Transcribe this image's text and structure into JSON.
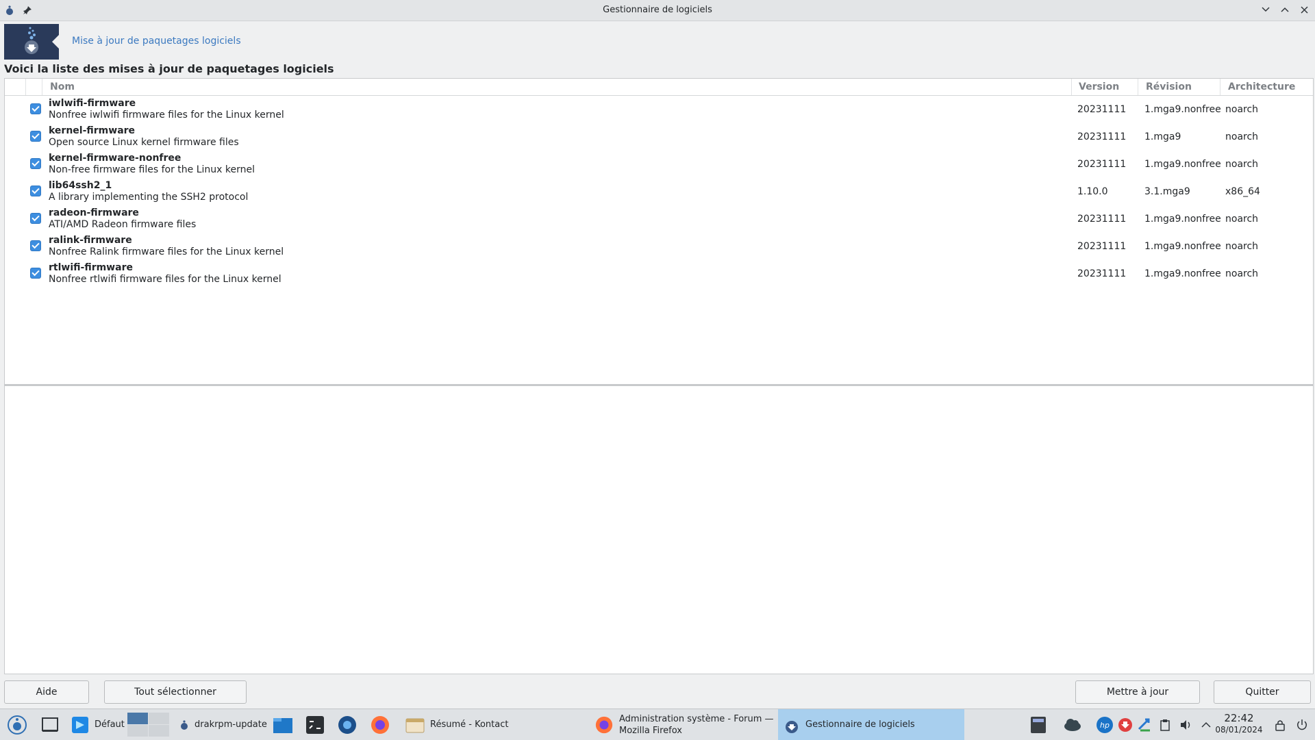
{
  "window": {
    "title": "Gestionnaire de logiciels"
  },
  "header": {
    "link": "Mise à jour de paquetages logiciels",
    "heading": "Voici la liste des mises à jour de paquetages logiciels"
  },
  "table": {
    "columns": [
      "Nom",
      "Version",
      "Révision",
      "Architecture"
    ],
    "rows": [
      {
        "name": "iwlwifi-firmware",
        "desc": "Nonfree iwlwifi firmware files for the Linux kernel",
        "version": "20231111",
        "revision": "1.mga9.nonfree",
        "arch": "noarch",
        "checked": true
      },
      {
        "name": "kernel-firmware",
        "desc": "Open source Linux kernel firmware files",
        "version": "20231111",
        "revision": "1.mga9",
        "arch": "noarch",
        "checked": true
      },
      {
        "name": "kernel-firmware-nonfree",
        "desc": "Non-free firmware files for the Linux kernel",
        "version": "20231111",
        "revision": "1.mga9.nonfree",
        "arch": "noarch",
        "checked": true
      },
      {
        "name": "lib64ssh2_1",
        "desc": "A library implementing the SSH2 protocol",
        "version": "1.10.0",
        "revision": "3.1.mga9",
        "arch": "x86_64",
        "checked": true
      },
      {
        "name": "radeon-firmware",
        "desc": "ATI/AMD Radeon firmware files",
        "version": "20231111",
        "revision": "1.mga9.nonfree",
        "arch": "noarch",
        "checked": true
      },
      {
        "name": "ralink-firmware",
        "desc": "Nonfree Ralink firmware files for the Linux kernel",
        "version": "20231111",
        "revision": "1.mga9.nonfree",
        "arch": "noarch",
        "checked": true
      },
      {
        "name": "rtlwifi-firmware",
        "desc": "Nonfree rtlwifi firmware files for the Linux kernel",
        "version": "20231111",
        "revision": "1.mga9.nonfree",
        "arch": "noarch",
        "checked": true
      }
    ]
  },
  "buttons": {
    "help": "Aide",
    "select_all": "Tout sélectionner",
    "update": "Mettre à jour",
    "quit": "Quitter"
  },
  "taskbar": {
    "desktop_label": "Défaut",
    "tasks": [
      {
        "label": "drakrpm-update"
      },
      {
        "label": "Résumé - Kontact"
      },
      {
        "label": "Administration système - Forum —\nMozilla Firefox"
      },
      {
        "label": "Gestionnaire de logiciels"
      }
    ],
    "clock_time": "22:42",
    "clock_date": "08/01/2024"
  },
  "colors": {
    "accent": "#3d8ee0",
    "link": "#3b79c0",
    "header_icon_bg": "#2a3a5a",
    "active_task": "#a8cfee"
  }
}
